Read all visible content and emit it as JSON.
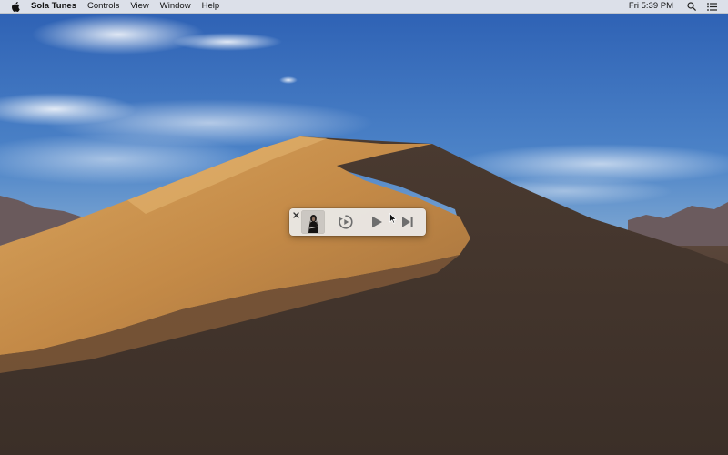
{
  "menubar": {
    "apple_icon": "apple-logo-icon",
    "app_name": "Sola Tunes",
    "menus": [
      "Controls",
      "View",
      "Window",
      "Help"
    ],
    "clock": "Fri 5:39 PM",
    "status_icons": [
      "search-icon",
      "notification-list-icon"
    ]
  },
  "mini_player": {
    "close_icon": "close-icon",
    "artwork": "album-artwork",
    "controls": [
      "replay-icon",
      "play-icon",
      "next-track-icon"
    ]
  },
  "colors": {
    "menubar_bg": "#ececee",
    "player_bg": "#ececec",
    "control_gray": "#6e6e6e"
  }
}
